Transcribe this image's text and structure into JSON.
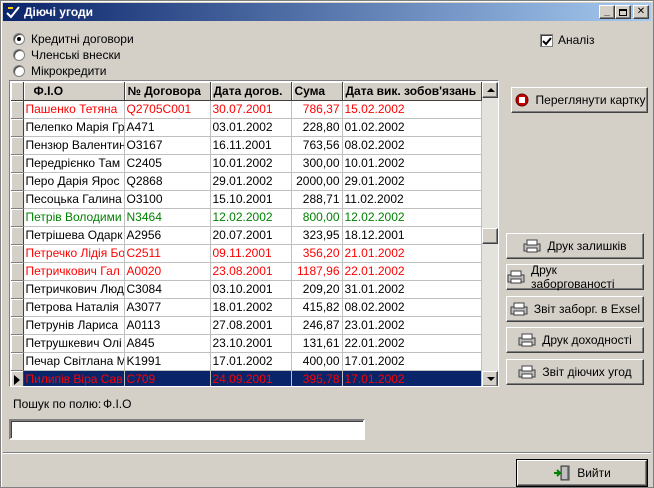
{
  "window": {
    "title": "Діючі угоди"
  },
  "radios": [
    {
      "label": "Кредитні договори",
      "checked": true
    },
    {
      "label": "Членські внески",
      "checked": false
    },
    {
      "label": "Мікрокредити",
      "checked": false
    }
  ],
  "analysis": {
    "label": "Аналіз",
    "checked": true
  },
  "grid": {
    "columns": [
      "Ф.І.О",
      "№ Договора",
      "Дата догов.",
      "Сума",
      "Дата вик. зобов'язань"
    ],
    "rows": [
      {
        "style": "red",
        "cells": [
          "Пашенко Тетяна",
          "Q2705C001",
          "30.07.2001",
          "786,37",
          "15.02.2002"
        ]
      },
      {
        "style": "normal",
        "cells": [
          "Пелепко Марія Гр",
          "A471",
          "03.01.2002",
          "228,80",
          "01.02.2002"
        ]
      },
      {
        "style": "normal",
        "cells": [
          "Пензюр Валентин",
          "O3167",
          "16.11.2001",
          "763,56",
          "08.02.2002"
        ]
      },
      {
        "style": "normal",
        "cells": [
          "Передрієнко Там",
          "C2405",
          "10.01.2002",
          "300,00",
          "10.01.2002"
        ]
      },
      {
        "style": "normal",
        "cells": [
          "Перо Дарія Ярос",
          "Q2868",
          "29.01.2002",
          "2000,00",
          "29.01.2002"
        ]
      },
      {
        "style": "normal",
        "cells": [
          "Песоцька Галина",
          "O3100",
          "15.10.2001",
          "288,71",
          "11.02.2002"
        ]
      },
      {
        "style": "green",
        "cells": [
          "Петрів Володими",
          "N3464",
          "12.02.2002",
          "800,00",
          "12.02.2002"
        ]
      },
      {
        "style": "normal",
        "cells": [
          "Петрішева Одарк",
          "A2956",
          "20.07.2001",
          "323,95",
          "18.12.2001"
        ]
      },
      {
        "style": "red",
        "cells": [
          "Петречко Лідія Бо",
          "C2511",
          "09.11.2001",
          "356,20",
          "21.01.2002"
        ]
      },
      {
        "style": "red",
        "cells": [
          "Петричкович Гал",
          "A0020",
          "23.08.2001",
          "1187,96",
          "22.01.2002"
        ]
      },
      {
        "style": "normal",
        "cells": [
          "Петричкович Люд",
          "C3084",
          "03.10.2001",
          "209,20",
          "31.01.2002"
        ]
      },
      {
        "style": "normal",
        "cells": [
          "Петрова Наталія",
          "A3077",
          "18.01.2002",
          "415,82",
          "08.02.2002"
        ]
      },
      {
        "style": "normal",
        "cells": [
          "Петрунів Лариса",
          "A0113",
          "27.08.2001",
          "246,87",
          "23.01.2002"
        ]
      },
      {
        "style": "normal",
        "cells": [
          "Петрушкевич Олі",
          "A845",
          "23.10.2001",
          "131,61",
          "22.01.2002"
        ]
      },
      {
        "style": "normal",
        "cells": [
          "Печар Світлана М",
          "K1991",
          "17.01.2002",
          "400,00",
          "17.01.2002"
        ]
      },
      {
        "style": "selected",
        "cells": [
          "Пилипів Віра Сав",
          "C709",
          "24.09.2001",
          "395,78",
          "17.01.2002"
        ]
      }
    ]
  },
  "buttons": {
    "view_card": "Переглянути картку",
    "print_balances": "Друк залишків",
    "print_debts": "Друк заборгованості",
    "export_excel": "Звіт заборг. в Exsel",
    "print_income": "Друк доходності",
    "report_active": "Звіт діючих угод",
    "exit": "Вийти"
  },
  "search": {
    "label": "Пошук по полю:",
    "field": "Ф.І.О",
    "value": ""
  },
  "colors": {
    "title_start": "#0a246a",
    "title_end": "#a6caf0",
    "selection": "#0a246a",
    "red_text": "#ff0000",
    "green_text": "#008000"
  }
}
